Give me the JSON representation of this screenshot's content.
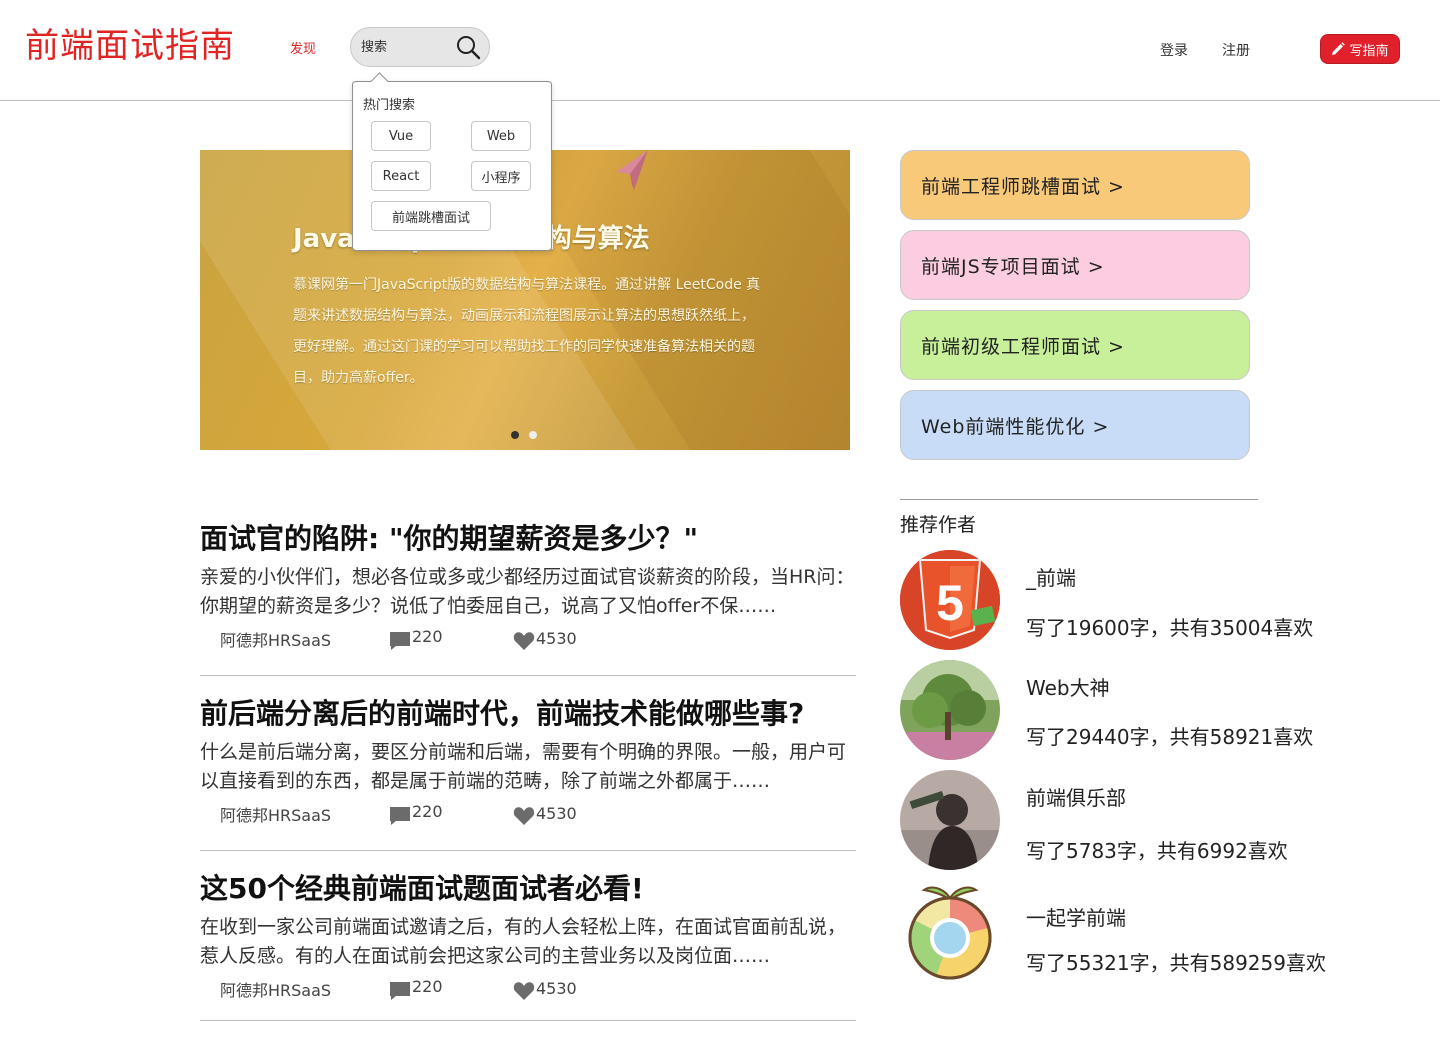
{
  "header": {
    "logo": "前端面试指南",
    "discover": "发现",
    "search_placeholder": "搜索",
    "login": "登录",
    "register": "注册",
    "write_label": "写指南"
  },
  "hot_search": {
    "title": "热门搜索",
    "tags": [
      "Vue",
      "Web",
      "React",
      "小程序",
      "前端跳槽面试"
    ]
  },
  "banner": {
    "title": "JavaScript版数据结构与算法",
    "description": "慕课网第一门JavaScript版的数据结构与算法课程。通过讲解 LeetCode 真题来讲述数据结构与算法，动画展示和流程图展示让算法的思想跃然纸上，更好理解。通过这门课的学习可以帮助找工作的同学快速准备算法相关的题目，助力高薪offer。",
    "slide_count": 2,
    "active_slide": 1
  },
  "articles": [
    {
      "title": "面试官的陷阱: \"你的期望薪资是多少？\"",
      "summary": "亲爱的小伙伴们，想必各位或多或少都经历过面试官谈薪资的阶段，当HR问：你期望的薪资是多少？说低了怕委屈自己，说高了又怕offer不保……",
      "author": "阿德邦HRSaaS",
      "comments": "220",
      "likes": "4530"
    },
    {
      "title": "前后端分离后的前端时代，前端技术能做哪些事?",
      "summary": "什么是前后端分离，要区分前端和后端，需要有个明确的界限。一般，用户可以直接看到的东西，都是属于前端的范畴，除了前端之外都属于……",
      "author": "阿德邦HRSaaS",
      "comments": "220",
      "likes": "4530"
    },
    {
      "title": "这50个经典前端面试题面试者必看!",
      "summary": "在收到一家公司前端面试邀请之后，有的人会轻松上阵，在面试官面前乱说，惹人反感。有的人在面试前会把这家公司的主营业务以及岗位面……",
      "author": "阿德邦HRSaaS",
      "comments": "220",
      "likes": "4530"
    }
  ],
  "topics": [
    {
      "label": "前端工程师跳槽面试 >",
      "color": "#f9c97a"
    },
    {
      "label": "前端JS专项目面试 >",
      "color": "#fccde0"
    },
    {
      "label": "前端初级工程师面试 >",
      "color": "#c8f09a"
    },
    {
      "label": "Web前端性能优化 >",
      "color": "#c8dcf8"
    }
  ],
  "authors_section": {
    "title": "推荐作者",
    "authors": [
      {
        "name": "_前端",
        "stats": "写了19600字，共有35004喜欢",
        "avatar": "html5-logo"
      },
      {
        "name": "Web大神",
        "stats": "写了29440字，共有58921喜欢",
        "avatar": "tree-photo"
      },
      {
        "name": "前端俱乐部",
        "stats": "写了5783字，共有6992喜欢",
        "avatar": "person-photo"
      },
      {
        "name": "一起学前端",
        "stats": "写了55321字，共有589259喜欢",
        "avatar": "chrome-sprout-logo"
      }
    ]
  },
  "colors": {
    "brand_red": "#e02424",
    "button_red": "#e0202a"
  }
}
